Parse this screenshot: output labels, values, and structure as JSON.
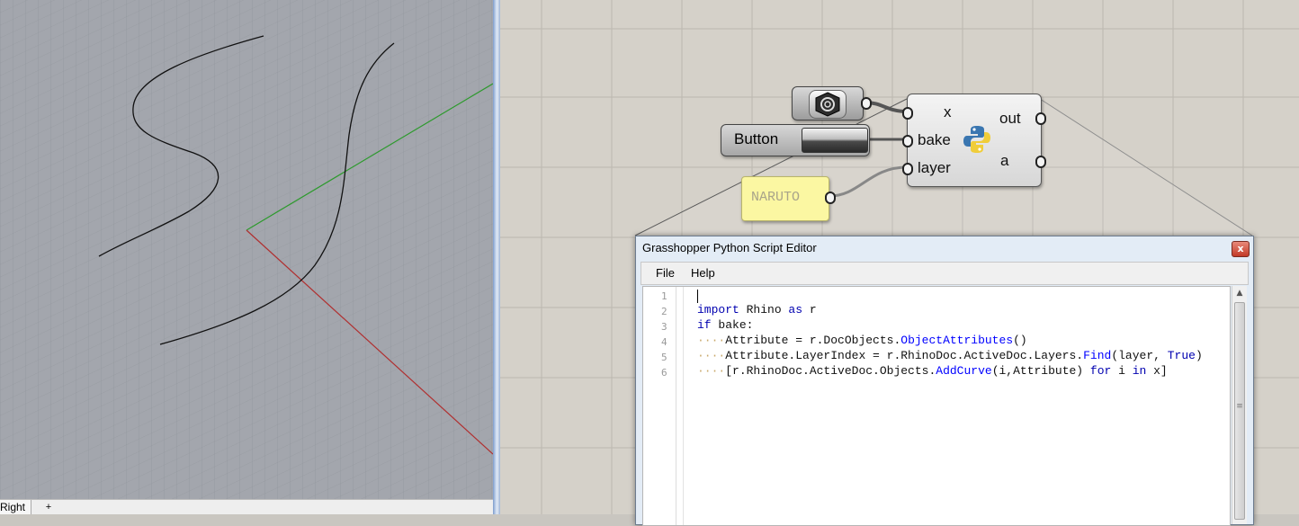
{
  "viewport": {
    "tab_label": "Right",
    "add_tab_symbol": "+"
  },
  "canvas": {
    "button_component": {
      "label": "Button"
    },
    "panel_component": {
      "text": "NARUTO"
    },
    "python_component": {
      "inputs": [
        "x",
        "bake",
        "layer"
      ],
      "outputs": [
        "out",
        "a"
      ]
    }
  },
  "editor": {
    "title": "Grasshopper Python Script Editor",
    "close_symbol": "x",
    "menu": [
      "File",
      "Help"
    ],
    "line_numbers": [
      "1",
      "2",
      "3",
      "4",
      "5",
      "6"
    ],
    "code": {
      "l2_import": "import",
      "l2_rhino": " Rhino ",
      "l2_as": "as",
      "l2_r": " r",
      "l3_if": "if",
      "l3_bake": " bake:",
      "indent": "····",
      "l4_a": "Attribute = r.DocObjects.",
      "l4_fn": "ObjectAttributes",
      "l4_b": "()",
      "l5_a": "Attribute.LayerIndex = r.RhinoDoc.ActiveDoc.Layers.",
      "l5_fn": "Find",
      "l5_b": "(layer, ",
      "l5_true": "True",
      "l5_c": ")",
      "l6_a": "[r.RhinoDoc.ActiveDoc.Objects.",
      "l6_fn": "AddCurve",
      "l6_b": "(i,Attribute) ",
      "l6_for": "for",
      "l6_i": " i ",
      "l6_in": "in",
      "l6_x": " x]"
    }
  }
}
